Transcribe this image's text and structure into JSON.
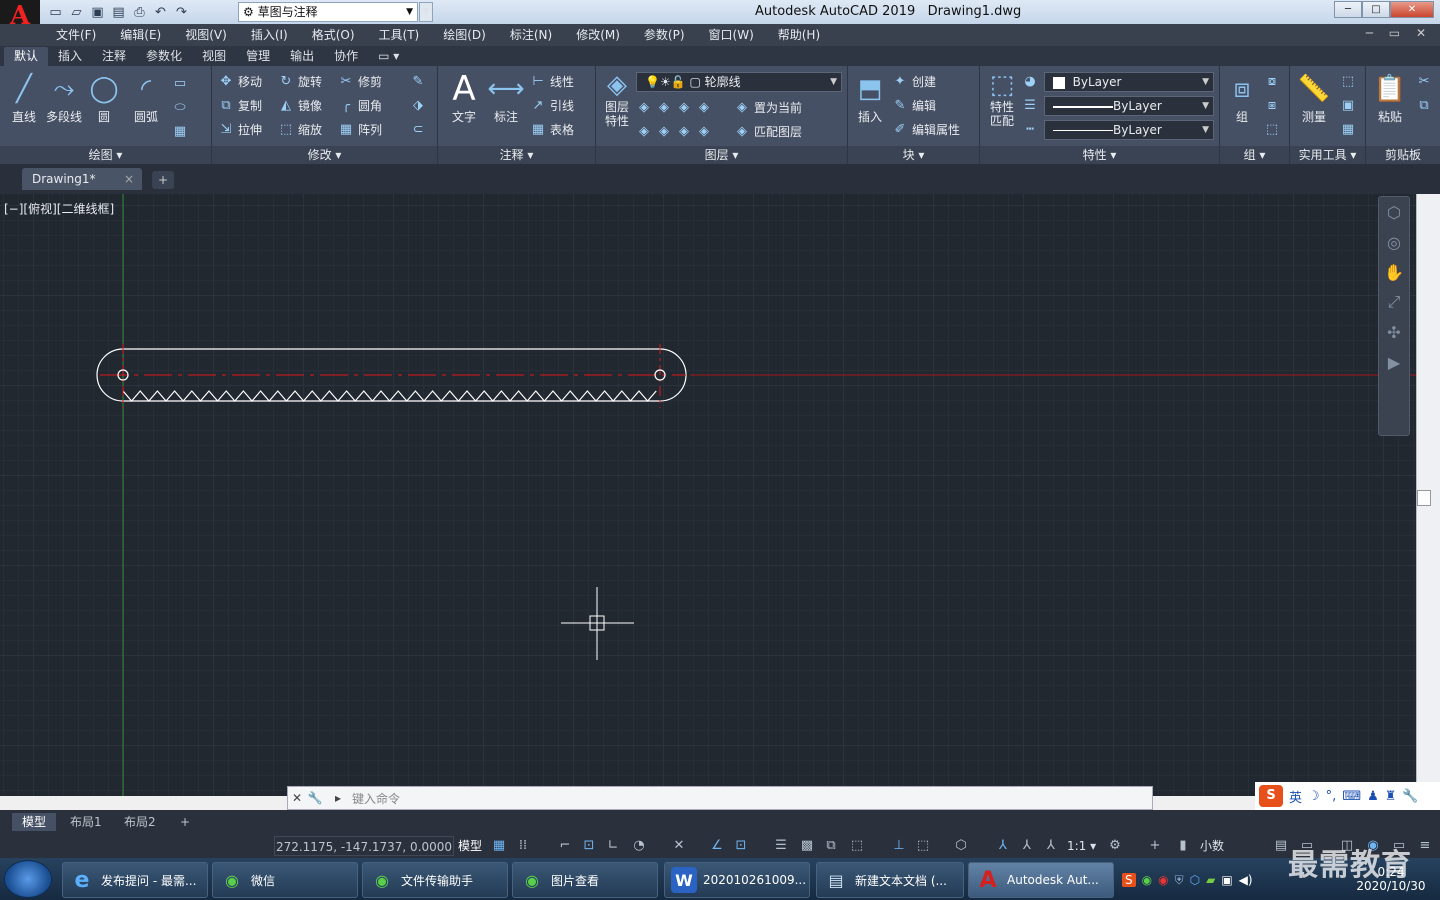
{
  "app": {
    "logo_letter": "A",
    "title": "Autodesk AutoCAD 2019",
    "file": "Drawing1.dwg",
    "workspace": "草图与注释"
  },
  "window_buttons": {
    "minimize": "─",
    "maximize": "□",
    "close": "✕"
  },
  "menu": [
    "文件(F)",
    "编辑(E)",
    "视图(V)",
    "插入(I)",
    "格式(O)",
    "工具(T)",
    "绘图(D)",
    "标注(N)",
    "修改(M)",
    "参数(P)",
    "窗口(W)",
    "帮助(H)"
  ],
  "ribbon_tabs": [
    "默认",
    "插入",
    "注释",
    "参数化",
    "视图",
    "管理",
    "输出",
    "协作"
  ],
  "ribbon_tab_extra": "▭ ▾",
  "ribbon": {
    "draw": {
      "title": "绘图 ▾",
      "line": "直线",
      "polyline": "多段线",
      "circle": "圆",
      "arc": "圆弧"
    },
    "modify": {
      "title": "修改 ▾",
      "move": "移动",
      "rotate": "旋转",
      "trim": "修剪",
      "copy": "复制",
      "mirror": "镜像",
      "fillet": "圆角",
      "stretch": "拉伸",
      "scale": "缩放",
      "array": "阵列"
    },
    "annotation": {
      "title": "注释 ▾",
      "text": "文字",
      "dimension": "标注",
      "linear": "线性",
      "leader": "引线",
      "table": "表格"
    },
    "layers": {
      "title": "图层 ▾",
      "layer_props": "图层\n特性",
      "current_layer": "轮廓线",
      "set_current": "置为当前",
      "match_layer": "匹配图层"
    },
    "block": {
      "title": "块 ▾",
      "insert": "插入",
      "create": "创建",
      "edit": "编辑",
      "edit_attr": "编辑属性"
    },
    "properties": {
      "title": "特性 ▾",
      "match": "特性\n匹配",
      "color": "ByLayer",
      "linetype": "ByLayer",
      "lineweight": "ByLayer"
    },
    "groups": {
      "title": "组 ▾",
      "group": "组"
    },
    "utilities": {
      "title": "实用工具 ▾",
      "measure": "测量"
    },
    "clipboard": {
      "title": "剪贴板",
      "paste": "粘贴"
    }
  },
  "doc_tab": {
    "name": "Drawing1*",
    "close": "×",
    "new": "+"
  },
  "viewport_label": "[−][俯视][二维线框]",
  "command_line": {
    "placeholder": "键入命令"
  },
  "layout_tabs": [
    "模型",
    "布局1",
    "布局2"
  ],
  "layout_add": "+",
  "status": {
    "coords": "272.1175, -147.1737, 0.0000",
    "model": "模型",
    "scale": "1:1 ▾",
    "units": "小数"
  },
  "ime": {
    "logo": "S",
    "lang": "英"
  },
  "taskbar": [
    {
      "label": "发布提问 - 最需...",
      "icon": "e",
      "color": "#2a8be0"
    },
    {
      "label": "微信",
      "icon": "◉",
      "color": "#3cb034"
    },
    {
      "label": "文件传输助手",
      "icon": "◉",
      "color": "#3cb034"
    },
    {
      "label": "图片查看",
      "icon": "◉",
      "color": "#3cb034"
    },
    {
      "label": "202010261009...",
      "icon": "W",
      "color": "#2b63c4"
    },
    {
      "label": "新建文本文档 (...",
      "icon": "▤",
      "color": "#8bb0d0"
    },
    {
      "label": "Autodesk Aut...",
      "icon": "A",
      "color": "#c81e1e"
    }
  ],
  "clock": {
    "time": "0:24",
    "date": "2020/10/30"
  },
  "watermark": "最需教育",
  "colors": {
    "canvas": "#212830",
    "outline": "#ffffff",
    "centerline": "#e01818",
    "ribbon": "#465064"
  }
}
